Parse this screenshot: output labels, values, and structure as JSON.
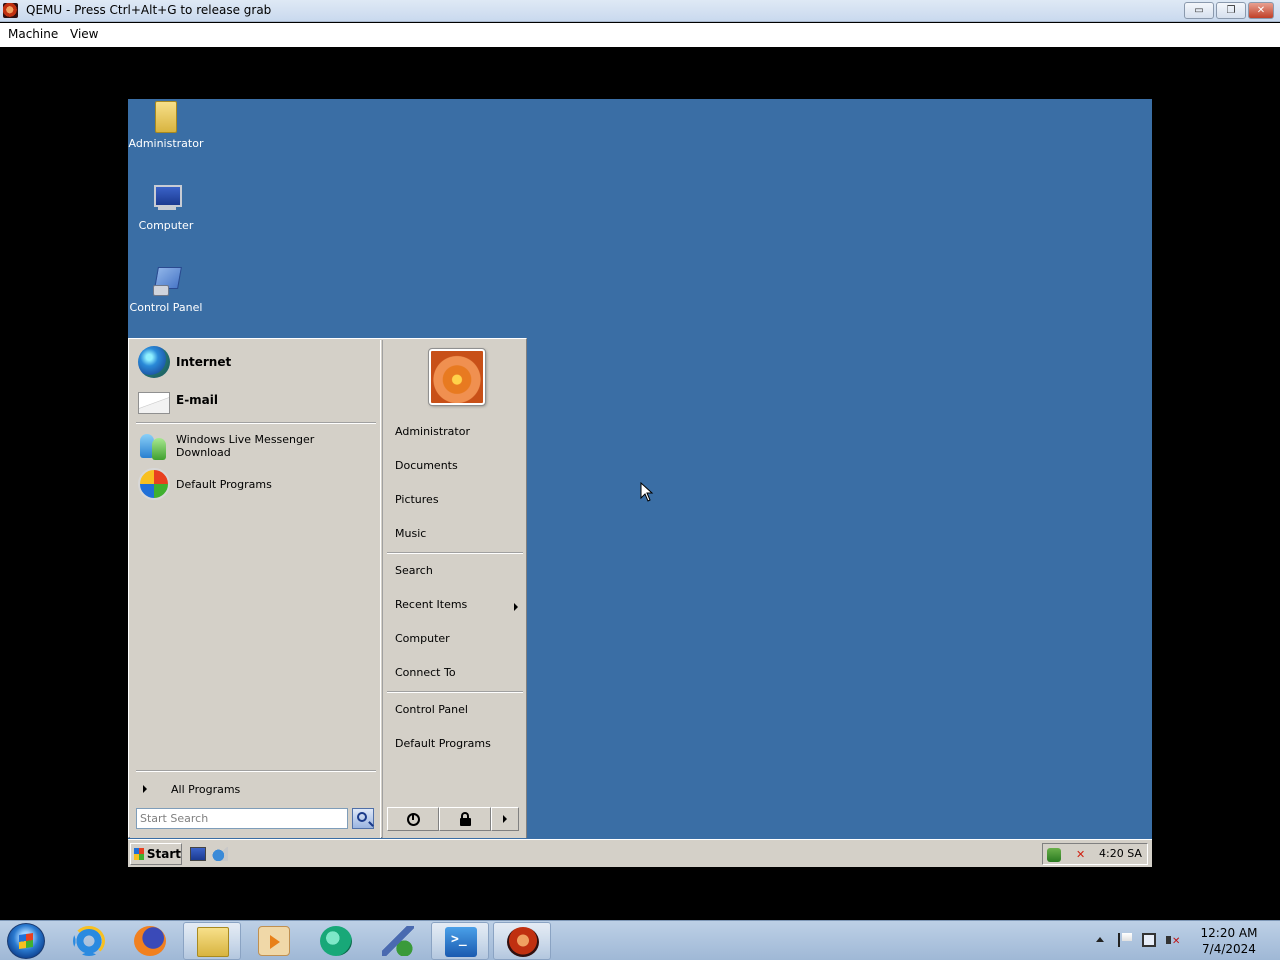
{
  "host": {
    "title": "QEMU - Press Ctrl+Alt+G to release grab",
    "menu": [
      "Machine",
      "View"
    ],
    "controls": {
      "minimize": "▭",
      "restore": "❐",
      "close": "✕"
    }
  },
  "guest": {
    "background_color": "#3a6ea5",
    "desktop_icons": [
      {
        "label": "Administrator",
        "icon": "user-folder-icon"
      },
      {
        "label": "Computer",
        "icon": "computer-icon"
      },
      {
        "label": "Control Panel",
        "icon": "control-panel-icon"
      }
    ],
    "start_menu": {
      "pinned": [
        {
          "label": "Internet",
          "icon": "globe-icon"
        },
        {
          "label": "E-mail",
          "icon": "mail-icon"
        }
      ],
      "recent": [
        {
          "label": "Windows Live Messenger Download",
          "icon": "messenger-icon"
        },
        {
          "label": "Default Programs",
          "icon": "default-programs-icon"
        }
      ],
      "all_programs": "All Programs",
      "search_placeholder": "Start Search",
      "right": {
        "group1": [
          "Administrator",
          "Documents",
          "Pictures",
          "Music"
        ],
        "group2": [
          "Search",
          "Recent Items",
          "Computer",
          "Connect To"
        ],
        "group3": [
          "Control Panel",
          "Default Programs"
        ]
      }
    },
    "taskbar": {
      "start_label": "Start",
      "clock": "4:20 SA"
    }
  },
  "host_taskbar": {
    "apps": [
      {
        "name": "internet-explorer",
        "icon": "ie-icon",
        "active": false
      },
      {
        "name": "firefox",
        "icon": "firefox-icon",
        "active": false
      },
      {
        "name": "file-explorer",
        "icon": "folder-icon",
        "active": true
      },
      {
        "name": "media-player",
        "icon": "media-player-icon",
        "active": false
      },
      {
        "name": "teal-app",
        "icon": "teal-app-icon",
        "active": false
      },
      {
        "name": "paint",
        "icon": "paint-icon",
        "active": false
      },
      {
        "name": "powershell",
        "icon": "powershell-icon",
        "active": true
      },
      {
        "name": "qemu",
        "icon": "qemu-icon",
        "active": true
      }
    ],
    "clock_time": "12:20 AM",
    "clock_date": "7/4/2024"
  }
}
